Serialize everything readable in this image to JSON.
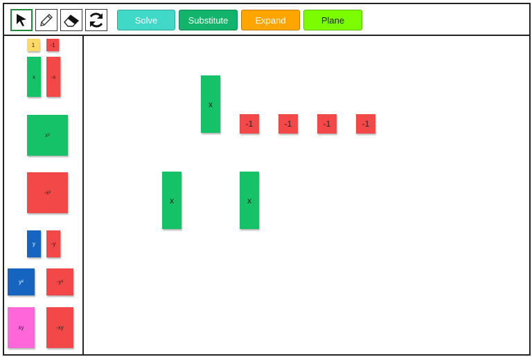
{
  "toolbar": {
    "tools": [
      {
        "name": "pointer-icon",
        "selected": true
      },
      {
        "name": "pencil-icon",
        "selected": false
      },
      {
        "name": "eraser-icon",
        "selected": false
      },
      {
        "name": "refresh-icon",
        "selected": false
      }
    ],
    "buttons": {
      "solve": "Solve",
      "substitute": "Substitute",
      "expand": "Expand",
      "plane": "Plane"
    }
  },
  "palette": {
    "one": "1",
    "neg_one": "-1",
    "x": "x",
    "neg_x": "-x",
    "x2": "x²",
    "neg_x2": "-x²",
    "y": "y",
    "neg_y": "-y",
    "y2": "y²",
    "neg_y2": "-y²",
    "xy": "xy",
    "neg_xy": "-xy"
  },
  "canvas": {
    "tiles": [
      {
        "label": "x"
      },
      {
        "label": "-1"
      },
      {
        "label": "-1"
      },
      {
        "label": "-1"
      },
      {
        "label": "-1"
      },
      {
        "label": "x"
      },
      {
        "label": "x"
      }
    ]
  },
  "colors": {
    "solve": "#40D9C8",
    "substitute": "#12B36A",
    "expand": "#FFA500",
    "plane": "#7CFC00",
    "positive_unit": "#FFD966",
    "negative": "#F24848",
    "x_tile": "#16C268",
    "y_tile": "#1565C0",
    "xy_tile": "#FF66D9"
  }
}
